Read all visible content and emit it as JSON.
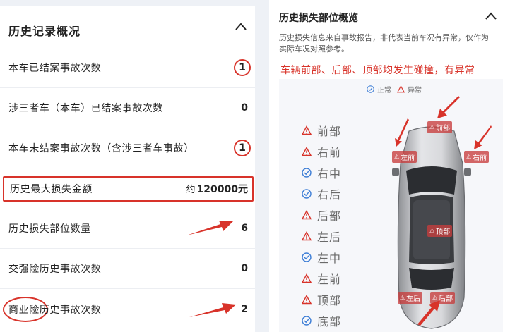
{
  "history": {
    "title": "历史记录概况",
    "rows": [
      {
        "label": "本车已结案事故次数",
        "value": "1"
      },
      {
        "label": "涉三者车（本车）已结案事故次数",
        "value": "0"
      },
      {
        "label": "本车未结案事故次数（含涉三者车事故）",
        "value": "1"
      },
      {
        "label": "历史最大损失金额",
        "value_prefix": "约",
        "value": "120000元"
      },
      {
        "label": "历史损失部位数量",
        "value": "6"
      },
      {
        "label": "交强险历史事故次数",
        "value": "0"
      },
      {
        "label": "商业险历史事故次数",
        "value": "2"
      }
    ]
  },
  "loss_overview": {
    "title": "历史损失部位概览",
    "note": "历史损失信息来自事故报告，非代表当前车况有异常，仅作为实际车况对照参考。",
    "warning": "车辆前部、后部、顶部均发生碰撞，有异常",
    "legend": {
      "normal": "正常",
      "abnormal": "异常"
    },
    "parts": [
      {
        "name": "前部",
        "status": "abnormal"
      },
      {
        "name": "右前",
        "status": "abnormal"
      },
      {
        "name": "右中",
        "status": "normal"
      },
      {
        "name": "右后",
        "status": "normal"
      },
      {
        "name": "后部",
        "status": "abnormal"
      },
      {
        "name": "左后",
        "status": "abnormal"
      },
      {
        "name": "左中",
        "status": "normal"
      },
      {
        "name": "左前",
        "status": "abnormal"
      },
      {
        "name": "顶部",
        "status": "abnormal"
      },
      {
        "name": "底部",
        "status": "normal"
      }
    ],
    "car_tags": {
      "front": "前部",
      "left_front": "左前",
      "right_front": "右前",
      "top": "顶部",
      "left_rear": "左后",
      "rear": "后部"
    }
  },
  "colors": {
    "accent_red": "#d8332a",
    "normal_blue": "#3f7fd6"
  }
}
